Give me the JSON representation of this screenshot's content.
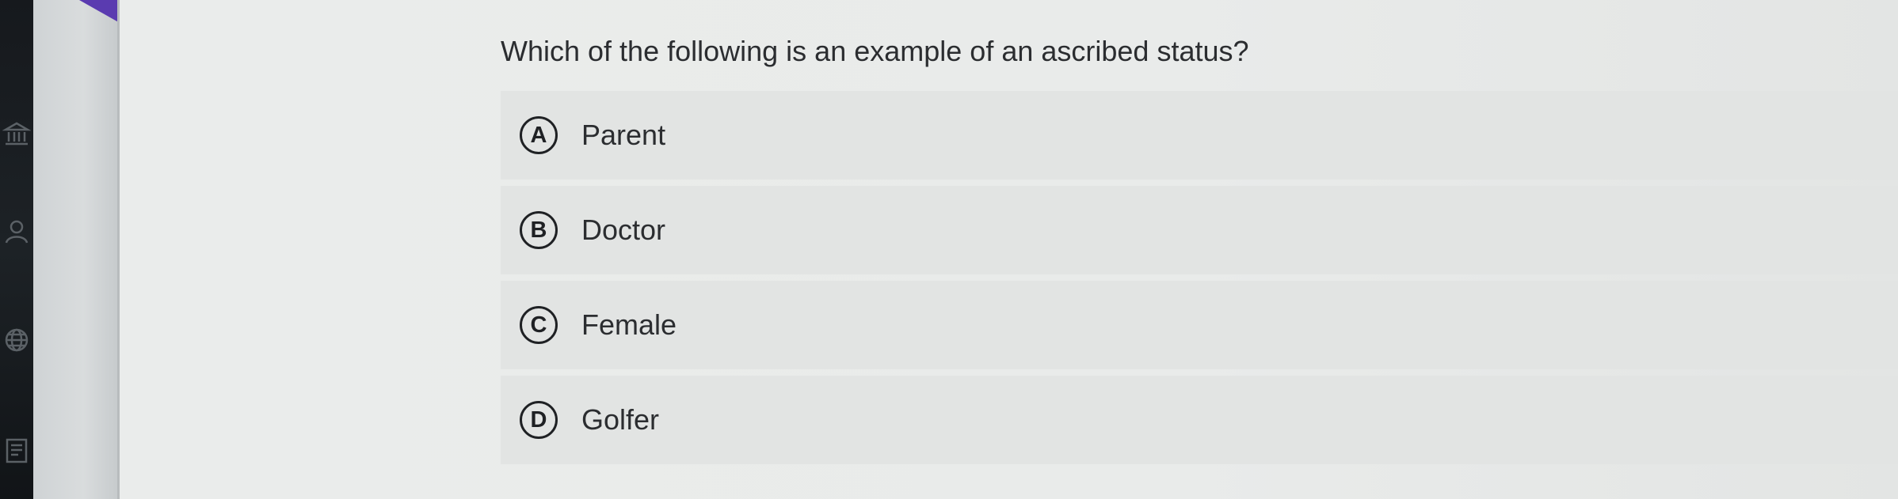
{
  "question": {
    "text": "Which of the following is an example of an ascribed status?"
  },
  "options": [
    {
      "letter": "A",
      "text": "Parent"
    },
    {
      "letter": "B",
      "text": "Doctor"
    },
    {
      "letter": "C",
      "text": "Female"
    },
    {
      "letter": "D",
      "text": "Golfer"
    }
  ],
  "nav_icons": [
    "bank-icon",
    "user-icon",
    "globe-icon",
    "document-icon"
  ],
  "colors": {
    "background": "#e9ebea",
    "option_background": "#e2e4e3",
    "text": "#2b2d30",
    "nav_background": "#16191d",
    "accent": "#5a3bb0"
  }
}
